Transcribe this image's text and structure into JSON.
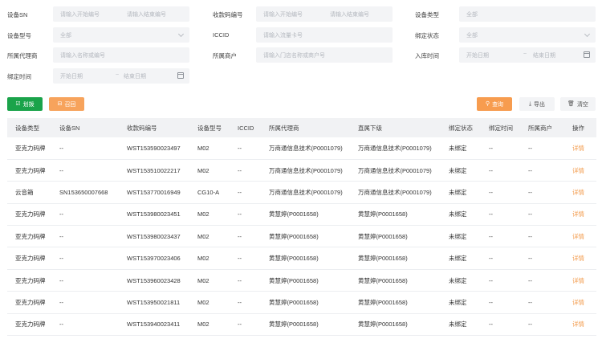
{
  "filters": {
    "device_sn": {
      "label": "设备SN",
      "start_placeholder": "请输入开始编号",
      "end_placeholder": "请输入结束编号"
    },
    "payment_code": {
      "label": "收款码编号",
      "start_placeholder": "请输入开始编号",
      "end_placeholder": "请输入结束编号"
    },
    "device_type": {
      "label": "设备类型",
      "value": "全部"
    },
    "device_model": {
      "label": "设备型号",
      "value": "全部"
    },
    "iccid": {
      "label": "ICCID",
      "placeholder": "请输入流量卡号"
    },
    "bind_status": {
      "label": "绑定状态",
      "value": "全部"
    },
    "agent": {
      "label": "所属代理商",
      "placeholder": "请输入名称或编号"
    },
    "merchant": {
      "label": "所属商户",
      "placeholder": "请输入门店名称或商户号"
    },
    "stock_time": {
      "label": "入库时间",
      "start_placeholder": "开始日期",
      "separator": "~",
      "end_placeholder": "结束日期"
    },
    "bind_time": {
      "label": "绑定时间",
      "start_placeholder": "开始日期",
      "separator": "~",
      "end_placeholder": "结束日期"
    }
  },
  "actions": {
    "bind": "划拨",
    "recall": "召回",
    "search": "查询",
    "export": "导出",
    "clear": "清空"
  },
  "table": {
    "headers": [
      "设备类型",
      "设备SN",
      "收款码编号",
      "设备型号",
      "ICCID",
      "所属代理商",
      "直属下级",
      "绑定状态",
      "绑定时间",
      "所属商户",
      "操作"
    ],
    "rows": [
      [
        "亚克力码牌",
        "--",
        "WST153590023497",
        "M02",
        "--",
        "万商通信息技术(P0001079)",
        "万商通信息技术(P0001079)",
        "未绑定",
        "--",
        "--",
        "详情"
      ],
      [
        "亚克力码牌",
        "--",
        "WST153510022217",
        "M02",
        "--",
        "万商通信息技术(P0001079)",
        "万商通信息技术(P0001079)",
        "未绑定",
        "--",
        "--",
        "详情"
      ],
      [
        "云音箱",
        "SN153650007668",
        "WST153770016949",
        "CG10-A",
        "--",
        "万商通信息技术(P0001079)",
        "万商通信息技术(P0001079)",
        "未绑定",
        "--",
        "--",
        "详情"
      ],
      [
        "亚克力码牌",
        "--",
        "WST153980023451",
        "M02",
        "--",
        "黄慧婷(P0001658)",
        "黄慧婷(P0001658)",
        "未绑定",
        "--",
        "--",
        "详情"
      ],
      [
        "亚克力码牌",
        "--",
        "WST153980023437",
        "M02",
        "--",
        "黄慧婷(P0001658)",
        "黄慧婷(P0001658)",
        "未绑定",
        "--",
        "--",
        "详情"
      ],
      [
        "亚克力码牌",
        "--",
        "WST153970023406",
        "M02",
        "--",
        "黄慧婷(P0001658)",
        "黄慧婷(P0001658)",
        "未绑定",
        "--",
        "--",
        "详情"
      ],
      [
        "亚克力码牌",
        "--",
        "WST153960023428",
        "M02",
        "--",
        "黄慧婷(P0001658)",
        "黄慧婷(P0001658)",
        "未绑定",
        "--",
        "--",
        "详情"
      ],
      [
        "亚克力码牌",
        "--",
        "WST153950021811",
        "M02",
        "--",
        "黄慧婷(P0001658)",
        "黄慧婷(P0001658)",
        "未绑定",
        "--",
        "--",
        "详情"
      ],
      [
        "亚克力码牌",
        "--",
        "WST153940023411",
        "M02",
        "--",
        "黄慧婷(P0001658)",
        "黄慧婷(P0001658)",
        "未绑定",
        "--",
        "--",
        "详情"
      ]
    ]
  }
}
